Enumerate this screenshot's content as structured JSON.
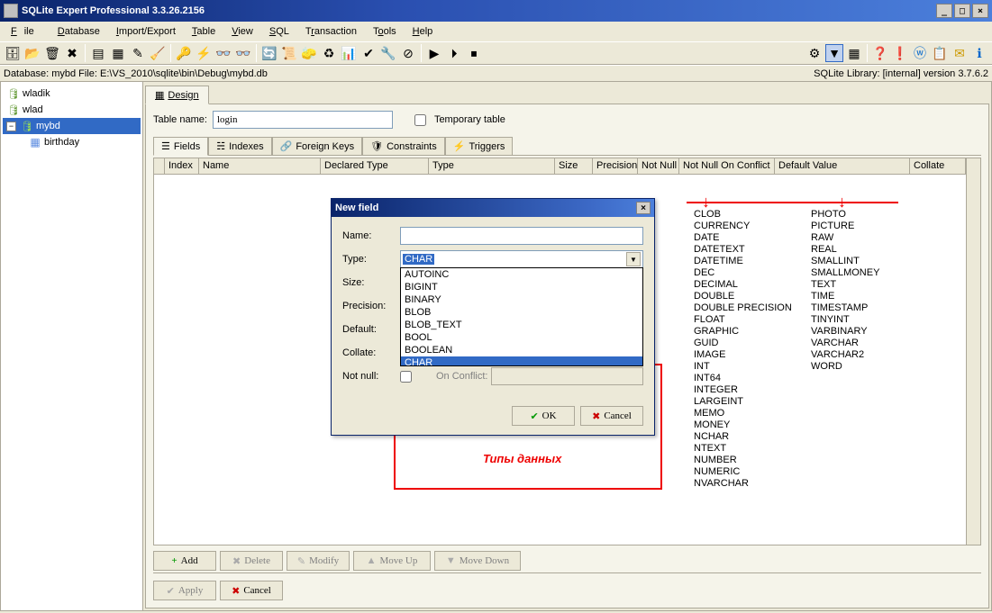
{
  "window": {
    "title": "SQLite Expert Professional 3.3.26.2156",
    "min": "_",
    "max": "□",
    "close": "×"
  },
  "menu": {
    "file": "File",
    "database": "Database",
    "import_export": "Import/Export",
    "table": "Table",
    "view": "View",
    "sql": "SQL",
    "transaction": "Transaction",
    "tools": "Tools",
    "help": "Help"
  },
  "status": {
    "left": "Database: mybd   File: E:\\VS_2010\\sqlite\\bin\\Debug\\mybd.db",
    "right": "SQLite Library: [internal] version 3.7.6.2"
  },
  "tree": {
    "items": [
      {
        "label": "wladik",
        "kind": "db"
      },
      {
        "label": "wlad",
        "kind": "db"
      },
      {
        "label": "mybd",
        "kind": "db",
        "selected": true,
        "expanded": true
      },
      {
        "label": "birthday",
        "kind": "table",
        "indent": true
      }
    ]
  },
  "main": {
    "design_tab": "Design",
    "table_name_label": "Table name:",
    "table_name_value": "login",
    "temp_label": "Temporary table",
    "subtabs": {
      "fields": "Fields",
      "indexes": "Indexes",
      "fk": "Foreign Keys",
      "constraints": "Constraints",
      "triggers": "Triggers"
    },
    "columns": {
      "index": "Index",
      "name": "Name",
      "declared": "Declared Type",
      "type": "Type",
      "size": "Size",
      "precision": "Precision",
      "notnull": "Not Null",
      "nnoc": "Not Null On Conflict",
      "default": "Default Value",
      "collate": "Collate"
    },
    "actions": {
      "add": "Add",
      "delete": "Delete",
      "modify": "Modify",
      "moveup": "Move Up",
      "movedown": "Move Down"
    },
    "bottom": {
      "apply": "Apply",
      "cancel": "Cancel"
    }
  },
  "modal": {
    "title": "New field",
    "labels": {
      "name": "Name:",
      "type": "Type:",
      "size": "Size:",
      "precision": "Precision:",
      "default": "Default:",
      "collate": "Collate:",
      "notnull": "Not null:",
      "onconflict": "On Conflict:"
    },
    "type_selected": "CHAR",
    "dropdown_items": [
      "AUTOINC",
      "BIGINT",
      "BINARY",
      "BLOB",
      "BLOB_TEXT",
      "BOOL",
      "BOOLEAN",
      "CHAR"
    ],
    "dropdown_selected": "CHAR",
    "ok": "OK",
    "cancel": "Cancel"
  },
  "types_col1": [
    "CLOB",
    "CURRENCY",
    "DATE",
    "DATETEXT",
    "DATETIME",
    "DEC",
    "DECIMAL",
    "DOUBLE",
    "DOUBLE PRECISION",
    "FLOAT",
    "GRAPHIC",
    "GUID",
    "IMAGE",
    "INT",
    "INT64",
    "INTEGER",
    "LARGEINT",
    "MEMO",
    "MONEY",
    "NCHAR",
    "NTEXT",
    "NUMBER",
    "NUMERIC",
    "NVARCHAR"
  ],
  "types_col2": [
    "PHOTO",
    "PICTURE",
    "RAW",
    "REAL",
    "SMALLINT",
    "SMALLMONEY",
    "TEXT",
    "TIME",
    "TIMESTAMP",
    "TINYINT",
    "VARBINARY",
    "VARCHAR",
    "VARCHAR2",
    "WORD"
  ],
  "annotation": "Типы данных"
}
